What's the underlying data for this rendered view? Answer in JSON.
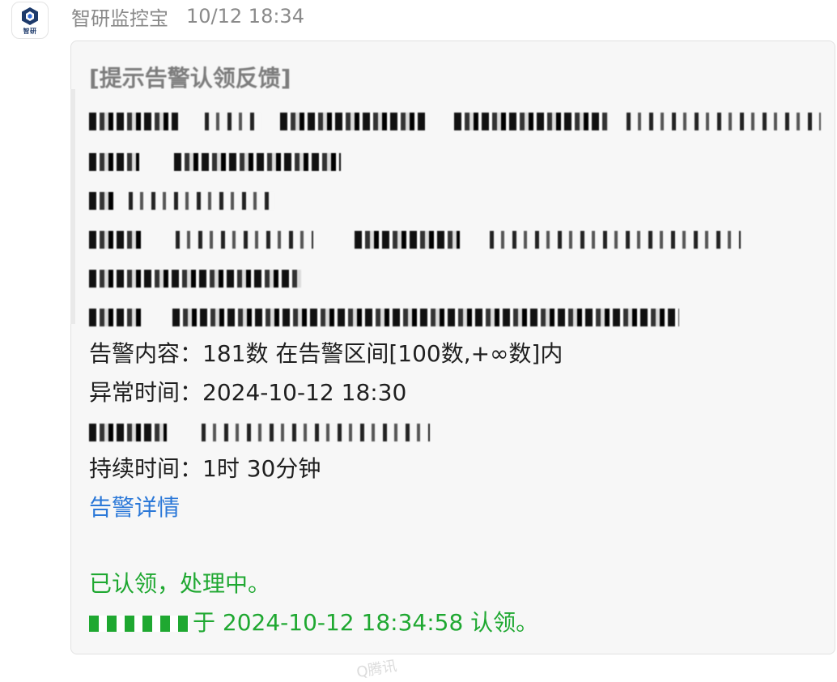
{
  "sender": {
    "name": "智研监控宝",
    "time": "10/12 18:34",
    "avatar_label": "智研",
    "avatar_icon": "cube-logo-icon"
  },
  "message": {
    "header": "[提示告警认领反馈]",
    "alert_content": "告警内容：181数 在告警区间[100数,+∞数]内",
    "abnormal_time": "异常时间：2024-10-12 18:30",
    "duration": "持续时间：1时 30分钟",
    "detail_link": "告警详情",
    "claimed_status": "已认领，处理中。",
    "claimed_by": "于 2024-10-12 18:34:58 认领。"
  },
  "watermark": "Q腾讯",
  "colors": {
    "green": "#1fa831",
    "link": "#2b78d8",
    "sender_gray": "#8a8a8a"
  }
}
